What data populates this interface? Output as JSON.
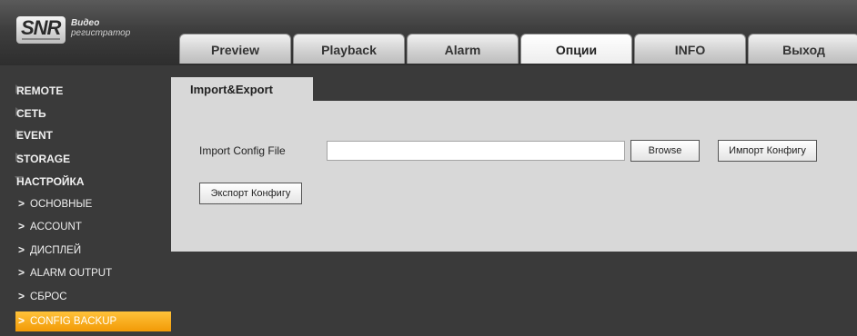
{
  "logo": {
    "brand": "SNR",
    "line1": "Видео",
    "line2": "регистратор"
  },
  "tabs": [
    {
      "label": "Preview"
    },
    {
      "label": "Playback"
    },
    {
      "label": "Alarm"
    },
    {
      "label": "Опции"
    },
    {
      "label": "INFO"
    },
    {
      "label": "Выход"
    }
  ],
  "active_tab": "Опции",
  "sidebar": {
    "items": [
      {
        "label": "REMOTE"
      },
      {
        "label": "СЕТЬ"
      },
      {
        "label": "EVENT"
      },
      {
        "label": "STORAGE"
      },
      {
        "label": "НАСТРОЙКА"
      }
    ],
    "subitems": [
      {
        "label": "ОСНОВНЫЕ"
      },
      {
        "label": "ACCOUNT"
      },
      {
        "label": "ДИСПЛЕЙ"
      },
      {
        "label": "ALARM OUTPUT"
      },
      {
        "label": "СБРОС"
      },
      {
        "label": "CONFIG BACKUP"
      }
    ],
    "active_subitem": "CONFIG BACKUP"
  },
  "content": {
    "tab_label": "Import&Export",
    "import_label": "Import Config File",
    "file_value": "",
    "browse_label": "Browse",
    "import_button": "Импорт Конфигу",
    "export_button": "Экспорт Конфигу"
  },
  "colors": {
    "accent": "#f5a00f",
    "panel": "#d8d8d8",
    "background": "#3a3a3a"
  }
}
